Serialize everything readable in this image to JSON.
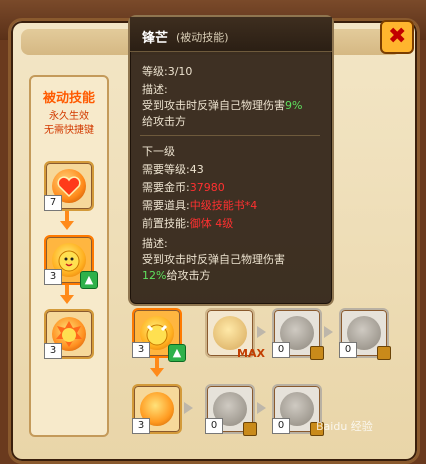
{
  "sidebar": {
    "title": "被动技能",
    "subtitle1": "永久生效",
    "subtitle2": "无需快捷键",
    "skills": [
      {
        "count": "7",
        "selected": false
      },
      {
        "count": "3",
        "selected": true,
        "upgradable": true
      },
      {
        "count": "3",
        "selected": false
      }
    ]
  },
  "tooltip": {
    "name": "锋芒",
    "type": "(被动技能)",
    "level": "等级:3/10",
    "desc_label": "描述:",
    "desc_line1_prefix": "受到攻击时反弹自己物理伤害",
    "desc_line1_value": "9%",
    "desc_line2": "给攻击方",
    "next_title": "下一级",
    "req_level": "需要等级:43",
    "req_gold_label": "需要金币:",
    "req_gold_value": "37980",
    "req_item_label": "需要道具:",
    "req_item_value": "中级技能书*4",
    "req_skill_label": "前置技能:",
    "req_skill_value": "御体 4级",
    "next_desc_label": "描述:",
    "next_desc_line1": "受到攻击时反弹自己物理伤害",
    "next_desc_value": "12%",
    "next_desc_line2": "给攻击方"
  },
  "tree": {
    "row1": [
      {
        "count": "3",
        "selected": true,
        "upgradable": true
      },
      {
        "count": "",
        "max_label": "MAX"
      },
      {
        "count": "0",
        "locked": true
      },
      {
        "count": "0",
        "locked": true
      }
    ],
    "row2": [
      {
        "count": "3"
      },
      {
        "count": "0",
        "locked": true
      },
      {
        "count": "0",
        "locked": true
      }
    ]
  },
  "colors": {
    "accent": "#ff7a00",
    "tooltip_bg": "#34261a",
    "green": "#5ee05e",
    "red": "#ff3030"
  },
  "close_icon": "close-x-icon",
  "watermark": "Baidu 经验"
}
